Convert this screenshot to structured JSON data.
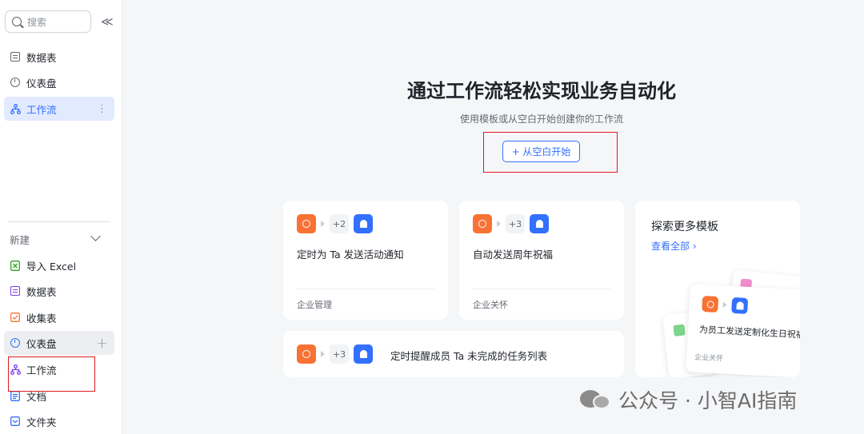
{
  "sidebar": {
    "search_placeholder": "搜索",
    "collapse_glyph": "≪",
    "top_items": [
      {
        "label": "数据表",
        "icon": "table-icon"
      },
      {
        "label": "仪表盘",
        "icon": "dashboard-icon"
      },
      {
        "label": "工作流",
        "icon": "workflow-icon",
        "active": true
      }
    ],
    "new_section_label": "新建",
    "new_items": [
      {
        "label": "导入 Excel",
        "icon": "excel-icon",
        "color": "#2ea121"
      },
      {
        "label": "数据表",
        "icon": "table-icon",
        "color": "#7f3bf5"
      },
      {
        "label": "收集表",
        "icon": "form-icon",
        "color": "#f77234"
      },
      {
        "label": "仪表盘",
        "icon": "dashboard-icon",
        "color": "#3370ff"
      },
      {
        "label": "工作流",
        "icon": "workflow-icon",
        "color": "#7f3bf5"
      },
      {
        "label": "文档",
        "icon": "doc-icon",
        "color": "#3370ff"
      },
      {
        "label": "文件夹",
        "icon": "folder-icon",
        "color": "#3370ff"
      }
    ]
  },
  "main": {
    "title": "通过工作流轻松实现业务自动化",
    "subtitle": "使用模板或从空白开始创建你的工作流",
    "start_button": "+ 从空白开始",
    "cards": [
      {
        "count": "+2",
        "title": "定时为 Ta 发送活动通知",
        "tag": "企业管理"
      },
      {
        "count": "+3",
        "title": "自动发送周年祝福",
        "tag": "企业关怀"
      },
      {
        "count": "+3",
        "title": "定时提醒成员 Ta 未完成的任务列表"
      }
    ],
    "explore": {
      "title": "探索更多模板",
      "link": "查看全部 ›",
      "preview_title": "为员工发送定制化生日祝福",
      "preview_tag": "企业关怀"
    }
  },
  "watermark": "公众号 · 小智AI指南",
  "colors": {
    "accent": "#3370ff",
    "orange": "#f77234",
    "highlight_box": "#e0191f"
  }
}
